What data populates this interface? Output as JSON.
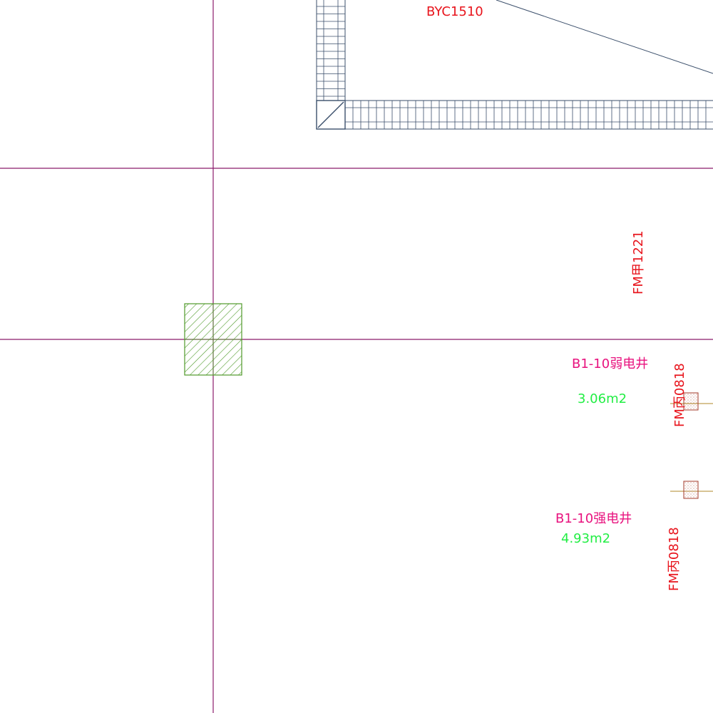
{
  "colors": {
    "background": "#ffffff",
    "grid_axis": "#8b1a6b",
    "stair": "#3b4f6b",
    "door_label": "#e8141c",
    "room_label": "#e8127e",
    "area_label": "#22ee44",
    "column_hatch": "#4f9a2a",
    "outlet": "#a33a2a",
    "outlet_stub": "#b08a2a"
  },
  "labels": {
    "window_byc": "BYC1510",
    "door_fm_jia": "FM甲1221",
    "door_fm_bing_1": "FM丙0818",
    "door_fm_bing_2": "FM丙0818",
    "room_weak": {
      "name": "B1-10弱电井",
      "area": "3.06m2"
    },
    "room_strong": {
      "name": "B1-10强电井",
      "area": "4.93m2"
    }
  },
  "icons": {
    "column": "hatched-column-icon",
    "outlet_1": "shaft-outlet-icon",
    "outlet_2": "shaft-outlet-icon"
  }
}
